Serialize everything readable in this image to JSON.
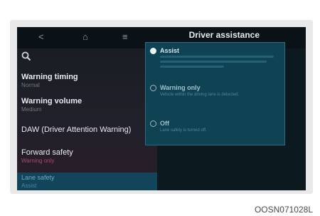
{
  "header": {
    "title": "Driver assistance"
  },
  "nav": {
    "back": "<",
    "home": "⌂",
    "menu": "≡",
    "search": "🔍"
  },
  "menu": {
    "items": [
      {
        "label": "Warning timing",
        "sub": "Normal"
      },
      {
        "label": "Warning volume",
        "sub": "Medium"
      },
      {
        "label": "DAW (Driver Attention Warning)",
        "sub": ""
      },
      {
        "label": "Forward safety",
        "sub": "Warning only"
      },
      {
        "label": "Lane safety",
        "sub": "Assist"
      }
    ]
  },
  "options": [
    {
      "label": "Assist",
      "selected": true
    },
    {
      "label": "Warning only",
      "desc": "Vehicle within the driving lane is detected.",
      "selected": false
    },
    {
      "label": "Off",
      "desc": "Lane safety is turned off.",
      "selected": false
    }
  ],
  "figure_code": "OOSN071028L"
}
